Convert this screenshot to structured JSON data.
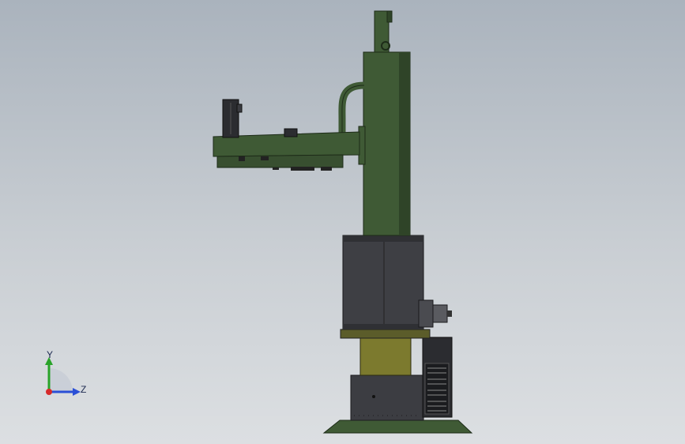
{
  "viewport": {
    "background_top": "#aab3bd",
    "background_bottom": "#dcdfe2"
  },
  "model": {
    "frame_color": "#3f5a35",
    "housing_color": "#3e3f44",
    "base_plate_color": "#7c7a2e",
    "cabinet_color": "#2b2c30"
  },
  "triad": {
    "y_label": "Y",
    "z_label": "Z",
    "y_color": "#29a329",
    "z_color": "#2a4fd6",
    "x_color": "#d62a2a"
  }
}
